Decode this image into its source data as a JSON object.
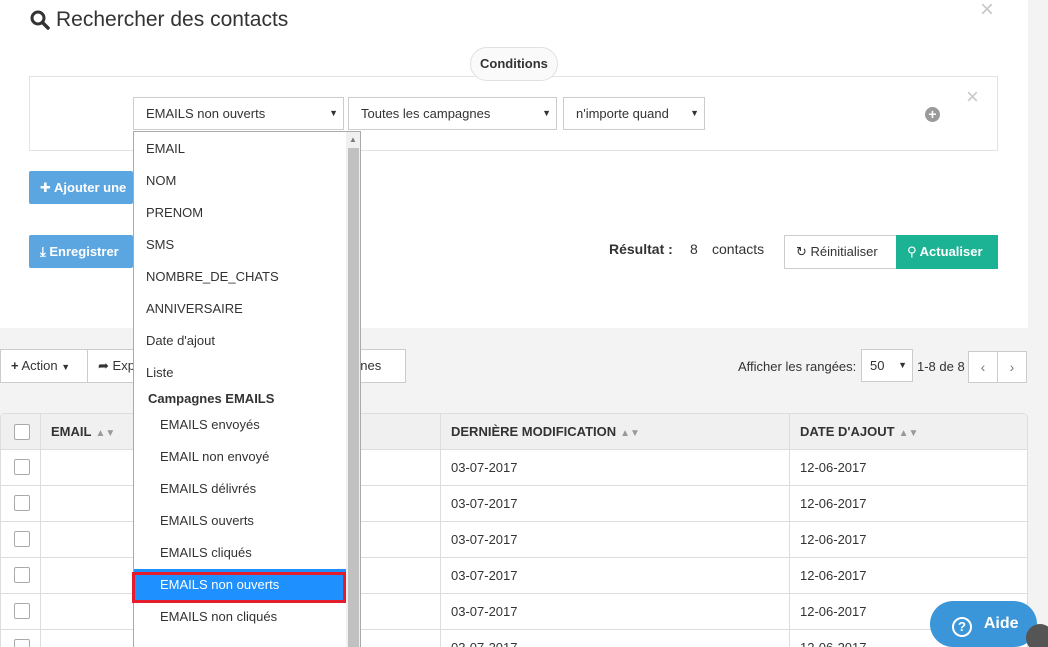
{
  "search": {
    "title": "Rechercher des contacts",
    "conditions_label": "Conditions",
    "condition": {
      "field_value": "EMAILS non ouverts",
      "campaign_value": "Toutes les campagnes",
      "time_value": "n'importe quand"
    },
    "add_button_label": "Ajouter une",
    "save_button_label": "Enregistrer",
    "result_label": "Résultat :",
    "result_count": "8",
    "result_unit": "contacts",
    "reset_label": "Réinitialiser",
    "refresh_label": "Actualiser"
  },
  "toolbar": {
    "action_label": "Action",
    "export_label": "Exp",
    "columns_label": "nnes",
    "rows_label": "Afficher les rangées:",
    "rows_value": "50",
    "pager_info": "1-8 de 8"
  },
  "table": {
    "headers": [
      "EMAIL",
      "DERNIÈRE MODIFICATION",
      "DATE D'AJOUT"
    ],
    "rows": [
      {
        "modified": "03-07-2017",
        "added": "12-06-2017"
      },
      {
        "modified": "03-07-2017",
        "added": "12-06-2017"
      },
      {
        "modified": "03-07-2017",
        "added": "12-06-2017"
      },
      {
        "modified": "03-07-2017",
        "added": "12-06-2017"
      },
      {
        "modified": "03-07-2017",
        "added": "12-06-2017"
      },
      {
        "modified": "03-07-2017",
        "added": "12-06-2017"
      }
    ]
  },
  "dropdown": {
    "items": [
      "EMAIL",
      "NOM",
      "PRENOM",
      "SMS",
      "NOMBRE_DE_CHATS",
      "ANNIVERSAIRE",
      "Date d'ajout",
      "Liste"
    ],
    "group_label": "Campagnes EMAILS",
    "group_items": [
      "EMAILS envoyés",
      "EMAIL non envoyé",
      "EMAILS délivrés",
      "EMAILS ouverts",
      "EMAILS cliqués",
      "EMAILS non ouverts",
      "EMAILS non cliqués"
    ],
    "selected": "EMAILS non ouverts"
  },
  "help": {
    "label": "Aide"
  },
  "colors": {
    "primary": "#5ba6e0",
    "success": "#1bb394",
    "selected": "#1e90ff",
    "highlight": "#e31d2b",
    "help": "#3b95d9"
  }
}
